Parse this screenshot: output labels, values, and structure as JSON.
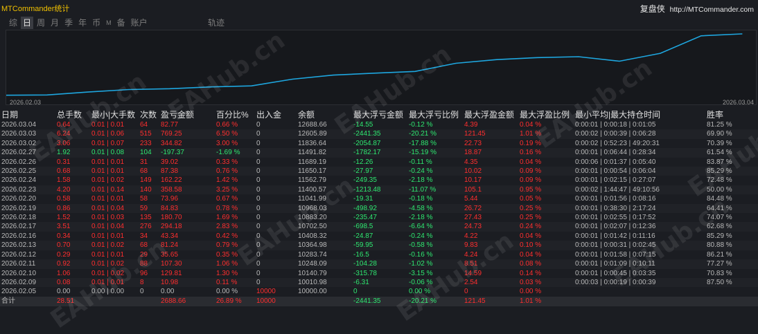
{
  "header": {
    "app_title": "MTCommander统计",
    "brand_cn": "复盘侠",
    "brand_url": "http://MTCommander.com"
  },
  "tabs": [
    "综",
    "日",
    "周",
    "月",
    "季",
    "年",
    "币",
    "M",
    "备",
    "账户"
  ],
  "active_tab": 1,
  "track_label": "轨迹",
  "chart_data": {
    "type": "line",
    "title": "",
    "x_start_label": "2026.02.03",
    "x_end_label": "2026.03.04",
    "line_color": "#1ea7e0",
    "x": [
      "2026.02.05",
      "2026.02.09",
      "2026.02.10",
      "2026.02.11",
      "2026.02.12",
      "2026.02.13",
      "2026.02.16",
      "2026.02.17",
      "2026.02.18",
      "2026.02.19",
      "2026.02.20",
      "2026.02.23",
      "2026.02.24",
      "2026.02.25",
      "2026.02.26",
      "2026.02.27",
      "2026.03.02",
      "2026.03.03",
      "2026.03.04"
    ],
    "y": [
      10000.0,
      10010.98,
      10140.79,
      10248.09,
      10283.74,
      10364.98,
      10408.32,
      10702.5,
      10883.2,
      10968.03,
      11041.99,
      11400.57,
      11562.79,
      11650.17,
      11689.19,
      11491.82,
      11836.64,
      12605.89,
      12688.66
    ],
    "ylim": [
      9900,
      12750
    ]
  },
  "table": {
    "headers": [
      "日期",
      "总手数",
      "最小|大手数",
      "次数",
      "盈亏金额",
      "百分比%",
      "出入金",
      "余额",
      "最大浮亏金额",
      "最大浮亏比例",
      "最大浮盈金额",
      "最大浮盈比例",
      "最小平均|最大持仓时间",
      "胜率"
    ],
    "rows": [
      [
        "2026.03.04",
        "0.64",
        "0.01 | 0.01",
        "64",
        "82.77",
        "0.66 %",
        "0",
        "12688.66",
        "-14.55",
        "-0.12 %",
        "4.39",
        "0.04 %",
        "0:00:01 | 0:00:18 | 0:01:05",
        "81.25 %"
      ],
      [
        "2026.03.03",
        "6.24",
        "0.01 | 0.06",
        "515",
        "769.25",
        "6.50 %",
        "0",
        "12605.89",
        "-2441.35",
        "-20.21 %",
        "121.45",
        "1.01 %",
        "0:00:02 | 0:00:39 | 0:06:28",
        "69.90 %"
      ],
      [
        "2026.03.02",
        "3.06",
        "0.01 | 0.07",
        "233",
        "344.82",
        "3.00 %",
        "0",
        "11836.64",
        "-2054.87",
        "-17.88 %",
        "22.73",
        "0.19 %",
        "0:00:02 | 0:52:23 | 49:20:31",
        "70.39 %"
      ],
      [
        "2026.02.27",
        "1.92",
        "0.01 | 0.08",
        "104",
        "-197.37",
        "-1.69 %",
        "0",
        "11491.82",
        "-1782.17",
        "-15.19 %",
        "18.87",
        "0.16 %",
        "0:00:01 | 0:06:44 | 0:28:34",
        "61.54 %"
      ],
      [
        "2026.02.26",
        "0.31",
        "0.01 | 0.01",
        "31",
        "39.02",
        "0.33 %",
        "0",
        "11689.19",
        "-12.26",
        "-0.11 %",
        "4.35",
        "0.04 %",
        "0:00:06 | 0:01:37 | 0:05:40",
        "83.87 %"
      ],
      [
        "2026.02.25",
        "0.68",
        "0.01 | 0.01",
        "68",
        "87.38",
        "0.76 %",
        "0",
        "11650.17",
        "-27.97",
        "-0.24 %",
        "10.02",
        "0.09 %",
        "0:00:01 | 0:00:54 | 0:06:04",
        "85.29 %"
      ],
      [
        "2026.02.24",
        "1.58",
        "0.01 | 0.02",
        "149",
        "162.22",
        "1.42 %",
        "0",
        "11562.79",
        "-249.35",
        "-2.18 %",
        "10.17",
        "0.09 %",
        "0:00:01 | 0:02:15 | 0:27:07",
        "72.48 %"
      ],
      [
        "2026.02.23",
        "4.20",
        "0.01 | 0.14",
        "140",
        "358.58",
        "3.25 %",
        "0",
        "11400.57",
        "-1213.48",
        "-11.07 %",
        "105.1",
        "0.95 %",
        "0:00:02 | 1:44:47 | 49:10:56",
        "50.00 %"
      ],
      [
        "2026.02.20",
        "0.58",
        "0.01 | 0.01",
        "58",
        "73.96",
        "0.67 %",
        "0",
        "11041.99",
        "-19.31",
        "-0.18 %",
        "5.44",
        "0.05 %",
        "0:00:01 | 0:01:56 | 0:08:16",
        "84.48 %"
      ],
      [
        "2026.02.19",
        "0.86",
        "0.01 | 0.04",
        "59",
        "84.83",
        "0.78 %",
        "0",
        "10968.03",
        "-498.92",
        "-4.58 %",
        "26.72",
        "0.25 %",
        "0:00:01 | 0:38:30 | 2:17:24",
        "64.41 %"
      ],
      [
        "2026.02.18",
        "1.52",
        "0.01 | 0.03",
        "135",
        "180.70",
        "1.69 %",
        "0",
        "10883.20",
        "-235.47",
        "-2.18 %",
        "27.43",
        "0.25 %",
        "0:00:01 | 0:02:55 | 0:17:52",
        "74.07 %"
      ],
      [
        "2026.02.17",
        "3.51",
        "0.01 | 0.04",
        "276",
        "294.18",
        "2.83 %",
        "0",
        "10702.50",
        "-698.5",
        "-6.64 %",
        "24.73",
        "0.24 %",
        "0:00:01 | 0:02:07 | 0:12:36",
        "62.68 %"
      ],
      [
        "2026.02.16",
        "0.34",
        "0.01 | 0.01",
        "34",
        "43.34",
        "0.42 %",
        "0",
        "10408.32",
        "-24.87",
        "-0.24 %",
        "4.22",
        "0.04 %",
        "0:00:01 | 0:01:42 | 0:11:16",
        "85.29 %"
      ],
      [
        "2026.02.13",
        "0.70",
        "0.01 | 0.02",
        "68",
        "81.24",
        "0.79 %",
        "0",
        "10364.98",
        "-59.95",
        "-0.58 %",
        "9.83",
        "0.10 %",
        "0:00:01 | 0:00:31 | 0:02:45",
        "80.88 %"
      ],
      [
        "2026.02.12",
        "0.29",
        "0.01 | 0.01",
        "29",
        "35.65",
        "0.35 %",
        "0",
        "10283.74",
        "-16.5",
        "-0.16 %",
        "4.24",
        "0.04 %",
        "0:00:01 | 0:01:58 | 0:07:15",
        "86.21 %"
      ],
      [
        "2026.02.11",
        "0.92",
        "0.01 | 0.02",
        "88",
        "107.30",
        "1.06 %",
        "0",
        "10248.09",
        "-104.28",
        "-1.02 %",
        "8.51",
        "0.08 %",
        "0:00:01 | 0:01:09 | 0:10:11",
        "77.27 %"
      ],
      [
        "2026.02.10",
        "1.06",
        "0.01 | 0.02",
        "96",
        "129.81",
        "1.30 %",
        "0",
        "10140.79",
        "-315.78",
        "-3.15 %",
        "14.59",
        "0.14 %",
        "0:00:01 | 0:00:45 | 0:03:35",
        "70.83 %"
      ],
      [
        "2026.02.09",
        "0.08",
        "0.01 | 0.01",
        "8",
        "10.98",
        "0.11 %",
        "0",
        "10010.98",
        "-6.31",
        "-0.06 %",
        "2.54",
        "0.03 %",
        "0:00:03 | 0:00:19 | 0:00:39",
        "87.50 %"
      ],
      [
        "2026.02.05",
        "0.00",
        "0.00 | 0.00",
        "0",
        "0.00",
        "0.00 %",
        "10000",
        "10000.00",
        "0",
        "0.00 %",
        "0",
        "0.00 %",
        "",
        ""
      ]
    ],
    "total": [
      "合计",
      "28.51",
      "",
      "",
      "2688.66",
      "26.89 %",
      "10000",
      "",
      "-2441.35",
      "-20.21 %",
      "121.45",
      "1.01 %",
      "",
      ""
    ]
  },
  "watermark": "EAHub.cn",
  "colors": {
    "profit": "#ff2e2e",
    "loss": "#2ee870",
    "neutral": "#b9b9b9",
    "accent": "#f0c000"
  }
}
